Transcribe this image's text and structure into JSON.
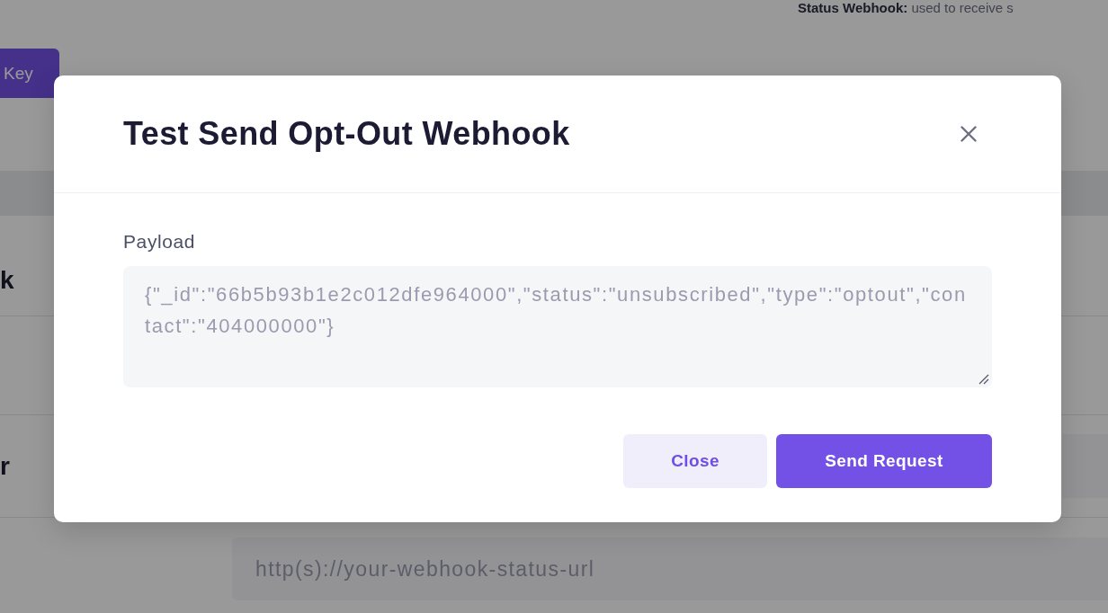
{
  "background_page": {
    "status_note": "**Status Webhook:** used to receive s",
    "key_button": "Key",
    "section_heading": "k",
    "field_row_label": "r",
    "url_field": {
      "placeholder": "http(s)://your-webhook-status-url"
    }
  },
  "modal": {
    "title": "Test Send Opt-Out Webhook",
    "payload": {
      "label": "Payload",
      "value": "{\"_id\":\"66b5b93b1e2c012dfe964000\",\"status\":\"unsubscribed\",\"type\":\"optout\",\"contact\":\"404000000\"}"
    },
    "buttons": [
      {
        "label": "Close",
        "kind": "secondary"
      },
      {
        "label": "Send Request",
        "kind": "primary"
      }
    ]
  }
}
